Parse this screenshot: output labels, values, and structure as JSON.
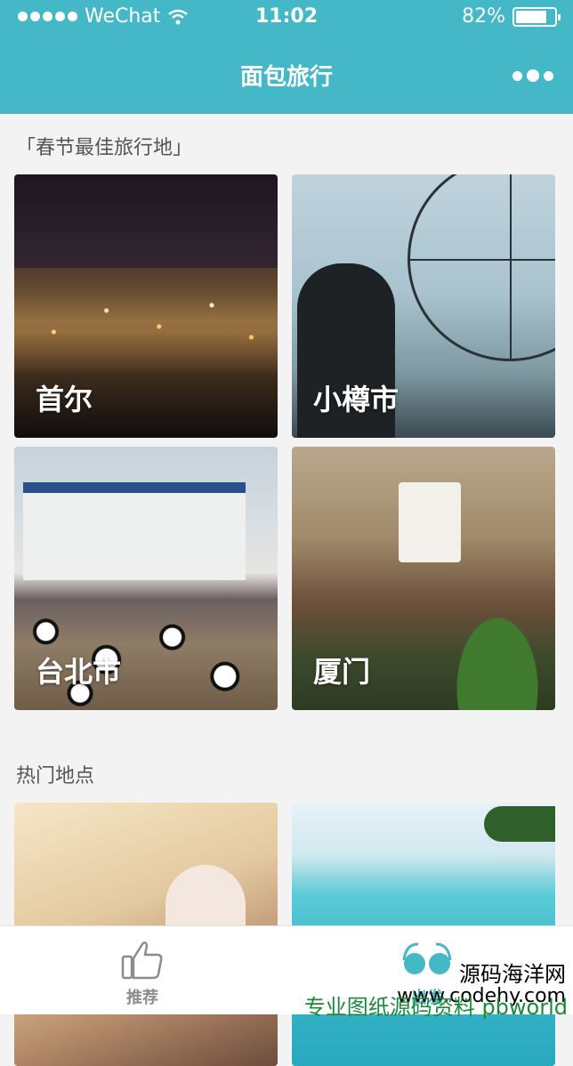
{
  "status_bar": {
    "carrier": "WeChat",
    "time": "11:02",
    "battery_percent": "82%",
    "battery_level": 0.82
  },
  "nav": {
    "title": "面包旅行"
  },
  "sections": {
    "festival_title": "「春节最佳旅行地」",
    "hot_title": "热门地点"
  },
  "destinations": [
    {
      "label": "首尔"
    },
    {
      "label": "小樽市"
    },
    {
      "label": "台北市"
    },
    {
      "label": "厦门"
    }
  ],
  "tabs": {
    "recommend": "推荐",
    "go": "出发"
  },
  "watermark": {
    "line1": "源码海洋网",
    "line2": "www.codehy.com",
    "line3": "专业图纸源码资料 pbworld"
  },
  "colors": {
    "accent": "#45b8c8"
  }
}
